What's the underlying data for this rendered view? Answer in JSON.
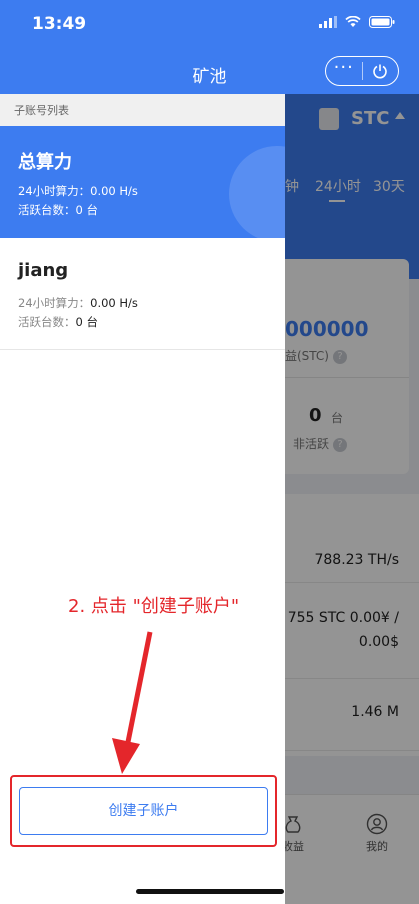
{
  "status_bar": {
    "time": "13:49"
  },
  "nav": {
    "title": "矿池",
    "more_label": "···"
  },
  "background": {
    "coin": "STC",
    "tabs": [
      "钟",
      "24小时",
      "30天"
    ],
    "big_value": "000000",
    "earnings_label": "益(STC)",
    "inactive_count": "0",
    "inactive_unit": "台",
    "inactive_label": "非活跃",
    "help_mark": "?",
    "rows": [
      "788.23 TH/s",
      "755 STC 0.00¥ /",
      "0.00$",
      "1.46 M"
    ],
    "tabbar": [
      "收益",
      "我的"
    ]
  },
  "drawer": {
    "header": "子账号列表",
    "accounts": [
      {
        "name": "总算力",
        "hashrate_label": "24小时算力：",
        "hashrate_value": "0.00 H/s",
        "active_label": "活跃台数：",
        "active_value": "0 台"
      },
      {
        "name": "jiang",
        "hashrate_label": "24小时算力：",
        "hashrate_value": "0.00 H/s",
        "active_label": "活跃台数：",
        "active_value": "0 台"
      }
    ],
    "create_button": "创建子账户"
  },
  "annotation": {
    "text": "2. 点击 \"创建子账户\""
  },
  "colors": {
    "primary": "#3d7cf0",
    "annotation": "#e4262b"
  }
}
